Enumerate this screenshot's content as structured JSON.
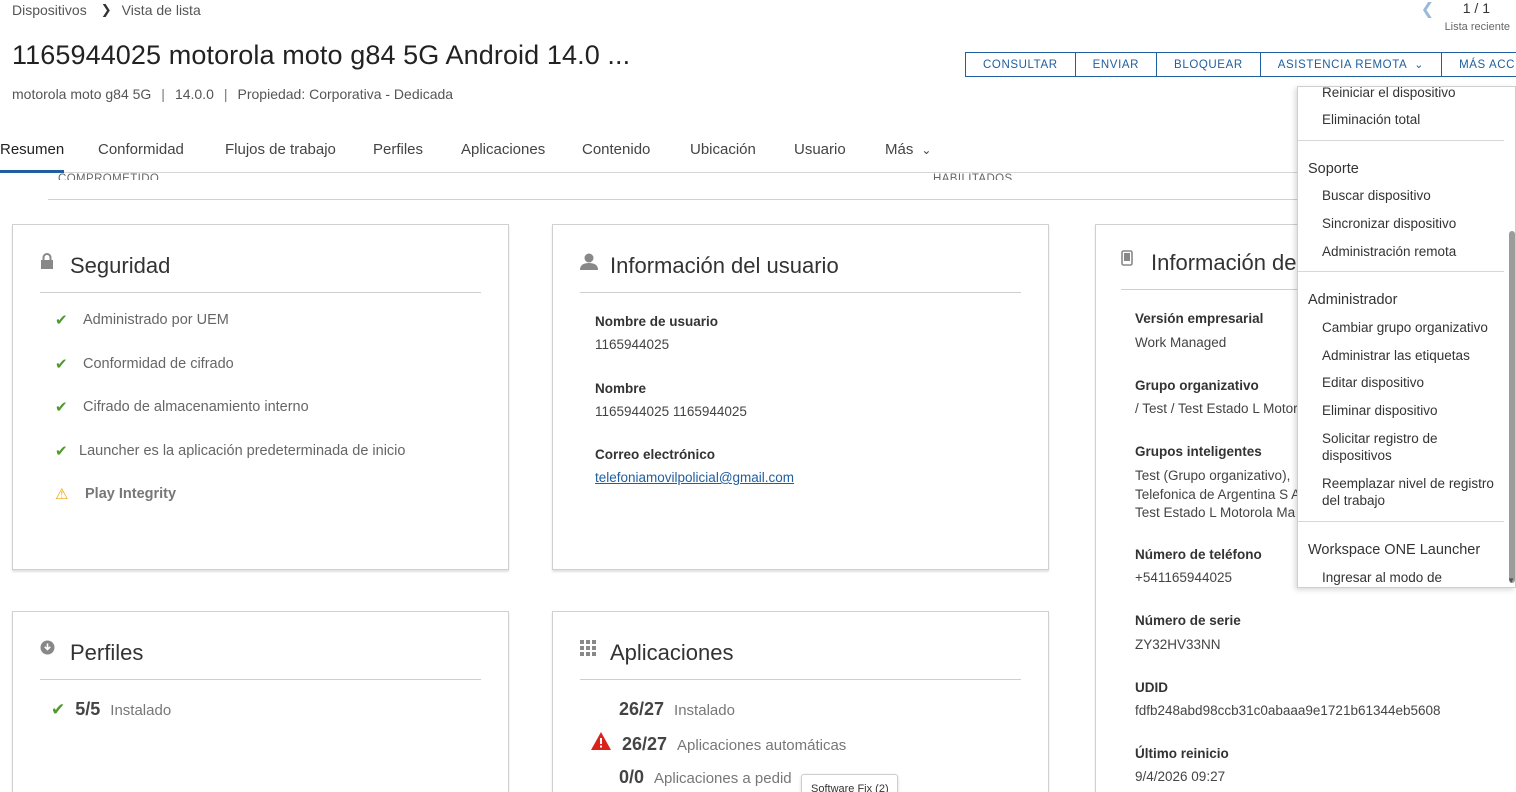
{
  "breadcrumb": {
    "root": "Dispositivos",
    "current": "Vista de lista"
  },
  "pager": {
    "value": "1 / 1",
    "recent": "Lista reciente"
  },
  "device": {
    "title": "1165944025 motorola moto g84 5G Android 14.0 ...",
    "model": "motorola moto g84 5G",
    "version": "14.0.0",
    "ownership": "Propiedad: Corporativa - Dedicada"
  },
  "actions": [
    "CONSULTAR",
    "ENVIAR",
    "BLOQUEAR",
    "ASISTENCIA REMOTA",
    "MÁS ACCIONES"
  ],
  "tabs": [
    "Resumen",
    "Conformidad",
    "Flujos de trabajo",
    "Perfiles",
    "Aplicaciones",
    "Contenido",
    "Ubicación",
    "Usuario",
    "Más"
  ],
  "faded": {
    "left": "COMPROMETIDO",
    "right": "HABILITADOS"
  },
  "security": {
    "title": "Seguridad",
    "items": [
      "Administrado por UEM",
      "Conformidad de cifrado",
      "Cifrado de almacenamiento interno",
      "Launcher es la aplicación predeterminada de inicio"
    ],
    "warning": "Play Integrity"
  },
  "user_info": {
    "title": "Información del usuario",
    "username_label": "Nombre de usuario",
    "username": "1165944025",
    "name_label": "Nombre",
    "name": "1165944025 1165944025",
    "email_label": "Correo electrónico",
    "email": "telefoniamovilpolicial@gmail.com"
  },
  "device_info": {
    "title": "Información de",
    "enterprise_label": "Versión empresarial",
    "enterprise": "Work Managed",
    "og_label": "Grupo organizativo",
    "og": "/ Test / Test Estado L Motor",
    "smart_label": "Grupos inteligentes",
    "smart": [
      "Test (Grupo organizativo),",
      "Telefonica de Argentina S A",
      "Test Estado L Motorola Ma"
    ],
    "phone_label": "Número de teléfono",
    "phone": "+541165944025",
    "serial_label": "Número de serie",
    "serial": "ZY32HV33NN",
    "udid_label": "UDID",
    "udid": "fdfb248abd98ccb31c0abaaa9e1721b61344eb5608",
    "reboot_label": "Último reinicio",
    "reboot": "9/4/2026 09:27"
  },
  "profiles": {
    "title": "Perfiles",
    "count": "5/5",
    "label": "Instalado"
  },
  "apps": {
    "title": "Aplicaciones",
    "rows": [
      {
        "count": "26/27",
        "label": "Instalado"
      },
      {
        "count": "26/27",
        "label": "Aplicaciones automáticas"
      },
      {
        "count": "0/0",
        "label": "Aplicaciones a pedid"
      }
    ]
  },
  "tooltip": "Software Fix (2)",
  "dropdown": {
    "top_items": [
      "Reiniciar el dispositivo",
      "Eliminación total"
    ],
    "support_label": "Soporte",
    "support_items": [
      "Buscar dispositivo",
      "Sincronizar dispositivo",
      "Administración remota"
    ],
    "admin_label": "Administrador",
    "admin_items": [
      "Cambiar grupo organizativo",
      "Administrar las etiquetas",
      "Editar dispositivo",
      "Eliminar dispositivo",
      "Solicitar registro de dispositivos",
      "Reemplazar nivel de registro del trabajo"
    ],
    "launcher_label": "Workspace ONE Launcher",
    "launcher_items": [
      "Ingresar al modo de"
    ]
  },
  "colors": {
    "accent": "#1f5fa0",
    "success": "#4f9a2f",
    "warning": "#f0a30a",
    "error": "#d9231b"
  }
}
